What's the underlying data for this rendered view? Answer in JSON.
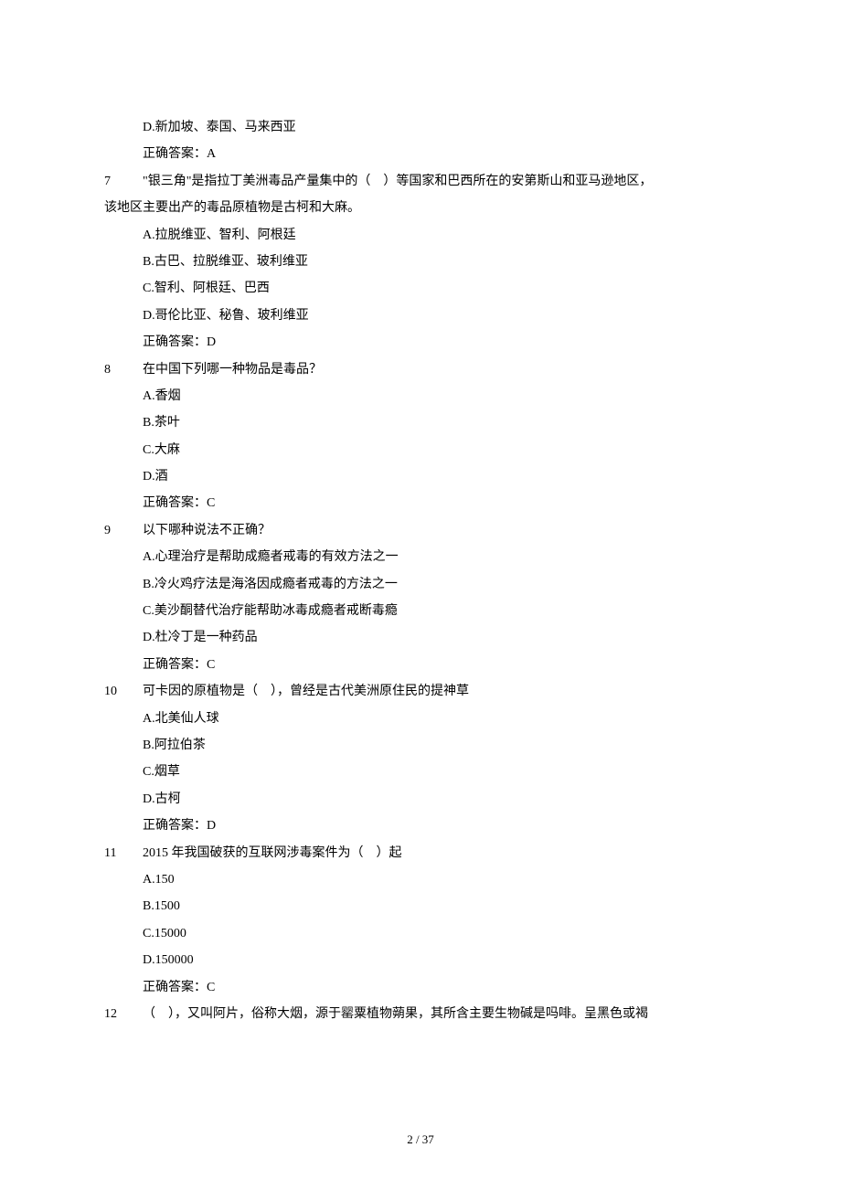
{
  "prelude": {
    "optionD": "D.新加坡、泰国、马来西亚",
    "answer": "正确答案：A"
  },
  "q7": {
    "num": "7",
    "text_line1": "\"银三角\"是指拉丁美洲毒品产量集中的（　）等国家和巴西所在的安第斯山和亚马逊地区，",
    "text_line2": "该地区主要出产的毒品原植物是古柯和大麻。",
    "optA": "A.拉脱维亚、智利、阿根廷",
    "optB": "B.古巴、拉脱维亚、玻利维亚",
    "optC": "C.智利、阿根廷、巴西",
    "optD": "D.哥伦比亚、秘鲁、玻利维亚",
    "answer": "正确答案：D"
  },
  "q8": {
    "num": "8",
    "text": "在中国下列哪一种物品是毒品？",
    "optA": "A.香烟",
    "optB": "B.茶叶",
    "optC": "C.大麻",
    "optD": "D.酒",
    "answer": "正确答案：C"
  },
  "q9": {
    "num": "9",
    "text": "以下哪种说法不正确？",
    "optA": "A.心理治疗是帮助成瘾者戒毒的有效方法之一",
    "optB": "B.冷火鸡疗法是海洛因成瘾者戒毒的方法之一",
    "optC": "C.美沙酮替代治疗能帮助冰毒成瘾者戒断毒瘾",
    "optD": "D.杜冷丁是一种药品",
    "answer": "正确答案：C"
  },
  "q10": {
    "num": "10",
    "text": "可卡因的原植物是（　），曾经是古代美洲原住民的提神草",
    "optA": "A.北美仙人球",
    "optB": "B.阿拉伯茶",
    "optC": "C.烟草",
    "optD": "D.古柯",
    "answer": "正确答案：D"
  },
  "q11": {
    "num": "11",
    "text": "2015 年我国破获的互联网涉毒案件为（　）起",
    "optA": "A.150",
    "optB": "B.1500",
    "optC": "C.15000",
    "optD": "D.150000",
    "answer": "正确答案：C"
  },
  "q12": {
    "num": "12",
    "text": "（　），又叫阿片，俗称大烟，源于罂粟植物蒴果，其所含主要生物碱是吗啡。呈黑色或褐"
  },
  "footer": "2 / 37"
}
